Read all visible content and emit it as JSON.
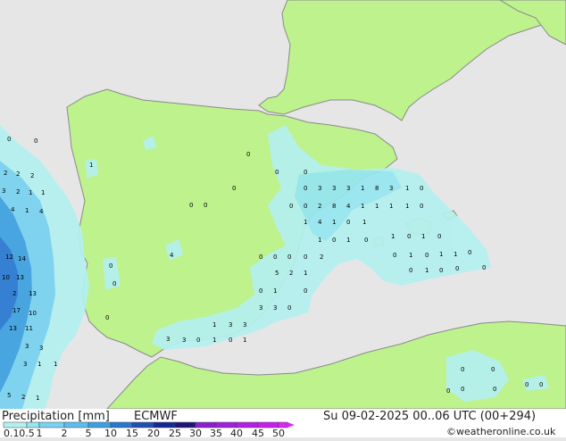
{
  "title": "Precipitation [mm]",
  "model": "ECMWF",
  "valid_time": "Su 09-02-2025 00..06 UTC (00+294)",
  "credit": "©weatheronline.co.uk",
  "colors": {
    "sea": "#e6e6e6",
    "land": "#bdf28c",
    "coast": "#8a8a8a",
    "border": "#b0b0b0"
  },
  "legend": {
    "ticks": [
      "0.1",
      "0.5",
      "1",
      "2",
      "5",
      "10",
      "15",
      "20",
      "25",
      "30",
      "35",
      "40",
      "45",
      "50"
    ],
    "colors": [
      "#b4f0f0",
      "#96e6f0",
      "#78d2f0",
      "#5abeec",
      "#3ca0e0",
      "#2878d2",
      "#1e50b4",
      "#142896",
      "#1e1478",
      "#8c1ed2",
      "#a01edc",
      "#b41ee6",
      "#c81ef0",
      "#dc28f5"
    ]
  }
}
